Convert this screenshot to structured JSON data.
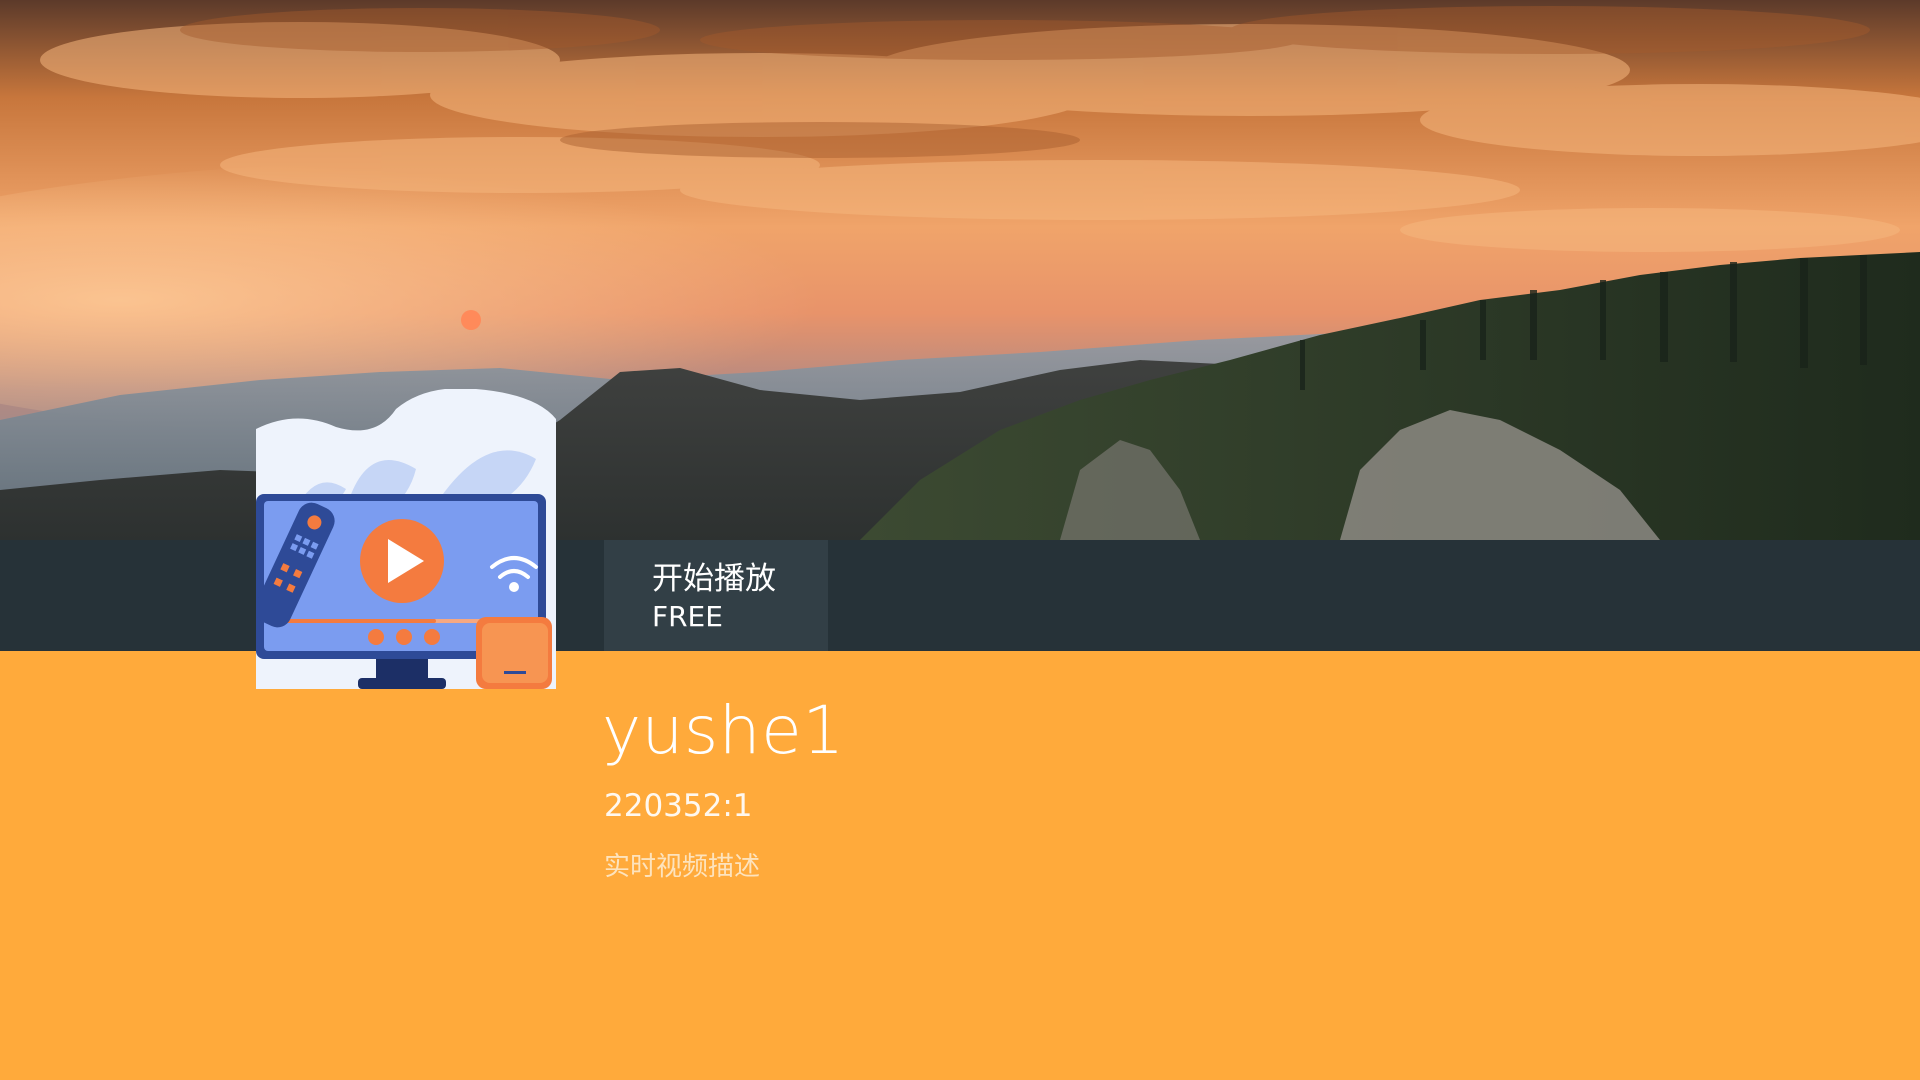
{
  "details": {
    "title": "yushe1",
    "subtitle": "220352:1",
    "description": "实时视频描述"
  },
  "actions": [
    {
      "label1": "开始播放",
      "label2": "FREE"
    }
  ],
  "colors": {
    "action_bar": "#263238",
    "action_item": "#323f46",
    "details_background": "#ffaa3b",
    "description_text": "#fde3bd",
    "poster_accent": "#f47b3f",
    "poster_screen": "#7b9cf0"
  },
  "icons": {
    "poster": "tv-play-remote-illustration",
    "play": "play-icon",
    "wifi": "wifi-icon"
  }
}
